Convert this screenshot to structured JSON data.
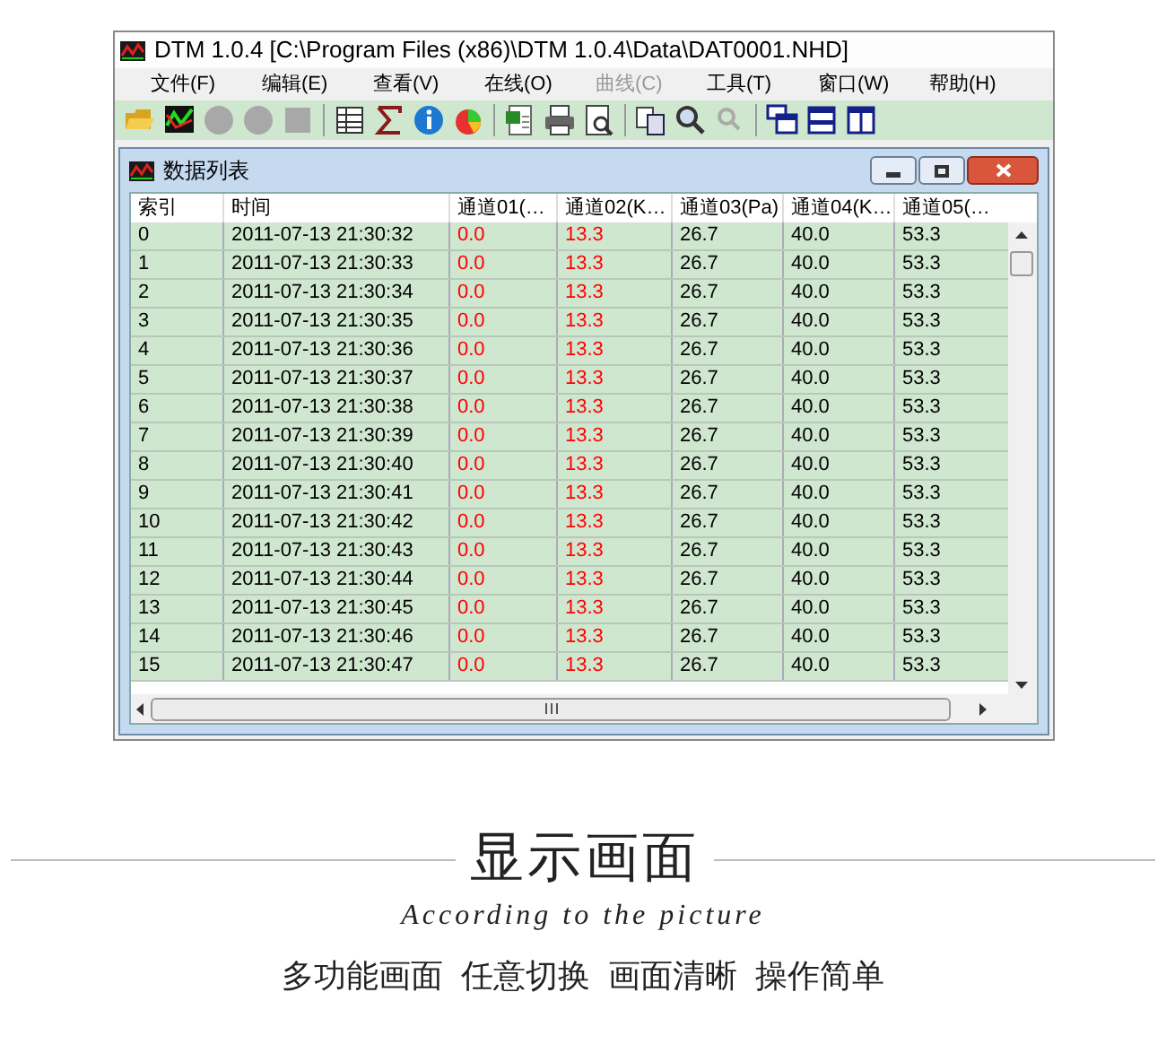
{
  "window": {
    "title": "DTM 1.0.4 [C:\\Program Files (x86)\\DTM 1.0.4\\Data\\DAT0001.NHD]"
  },
  "menu": [
    {
      "label": "文件(F)",
      "disabled": false
    },
    {
      "label": "编辑(E)",
      "disabled": false
    },
    {
      "label": "查看(V)",
      "disabled": false
    },
    {
      "label": "在线(O)",
      "disabled": false
    },
    {
      "label": "曲线(C)",
      "disabled": true
    },
    {
      "label": "工具(T)",
      "disabled": false
    },
    {
      "label": "窗口(W)",
      "disabled": false
    },
    {
      "label": "帮助(H)",
      "disabled": false
    }
  ],
  "child_window": {
    "title": "数据列表"
  },
  "table": {
    "columns": [
      {
        "label": "索引",
        "color": "#000000"
      },
      {
        "label": "时间",
        "color": "#000000"
      },
      {
        "label": "通道01(…",
        "color": "#ff0000"
      },
      {
        "label": "通道02(K…",
        "color": "#ff0000"
      },
      {
        "label": "通道03(Pa)",
        "color": "#000000"
      },
      {
        "label": "通道04(K…",
        "color": "#000000"
      },
      {
        "label": "通道05(…",
        "color": "#000000"
      }
    ],
    "rows": [
      [
        "0",
        "2011-07-13 21:30:32",
        "0.0",
        "13.3",
        "26.7",
        "40.0",
        "53.3"
      ],
      [
        "1",
        "2011-07-13 21:30:33",
        "0.0",
        "13.3",
        "26.7",
        "40.0",
        "53.3"
      ],
      [
        "2",
        "2011-07-13 21:30:34",
        "0.0",
        "13.3",
        "26.7",
        "40.0",
        "53.3"
      ],
      [
        "3",
        "2011-07-13 21:30:35",
        "0.0",
        "13.3",
        "26.7",
        "40.0",
        "53.3"
      ],
      [
        "4",
        "2011-07-13 21:30:36",
        "0.0",
        "13.3",
        "26.7",
        "40.0",
        "53.3"
      ],
      [
        "5",
        "2011-07-13 21:30:37",
        "0.0",
        "13.3",
        "26.7",
        "40.0",
        "53.3"
      ],
      [
        "6",
        "2011-07-13 21:30:38",
        "0.0",
        "13.3",
        "26.7",
        "40.0",
        "53.3"
      ],
      [
        "7",
        "2011-07-13 21:30:39",
        "0.0",
        "13.3",
        "26.7",
        "40.0",
        "53.3"
      ],
      [
        "8",
        "2011-07-13 21:30:40",
        "0.0",
        "13.3",
        "26.7",
        "40.0",
        "53.3"
      ],
      [
        "9",
        "2011-07-13 21:30:41",
        "0.0",
        "13.3",
        "26.7",
        "40.0",
        "53.3"
      ],
      [
        "10",
        "2011-07-13 21:30:42",
        "0.0",
        "13.3",
        "26.7",
        "40.0",
        "53.3"
      ],
      [
        "11",
        "2011-07-13 21:30:43",
        "0.0",
        "13.3",
        "26.7",
        "40.0",
        "53.3"
      ],
      [
        "12",
        "2011-07-13 21:30:44",
        "0.0",
        "13.3",
        "26.7",
        "40.0",
        "53.3"
      ],
      [
        "13",
        "2011-07-13 21:30:45",
        "0.0",
        "13.3",
        "26.7",
        "40.0",
        "53.3"
      ],
      [
        "14",
        "2011-07-13 21:30:46",
        "0.0",
        "13.3",
        "26.7",
        "40.0",
        "53.3"
      ],
      [
        "15",
        "2011-07-13 21:30:47",
        "0.0",
        "13.3",
        "26.7",
        "40.0",
        "53.3"
      ]
    ]
  },
  "caption": {
    "heading": "显示画面",
    "subheading": "According to the picture",
    "features": "多功能画面  任意切换  画面清晰  操作简单"
  }
}
